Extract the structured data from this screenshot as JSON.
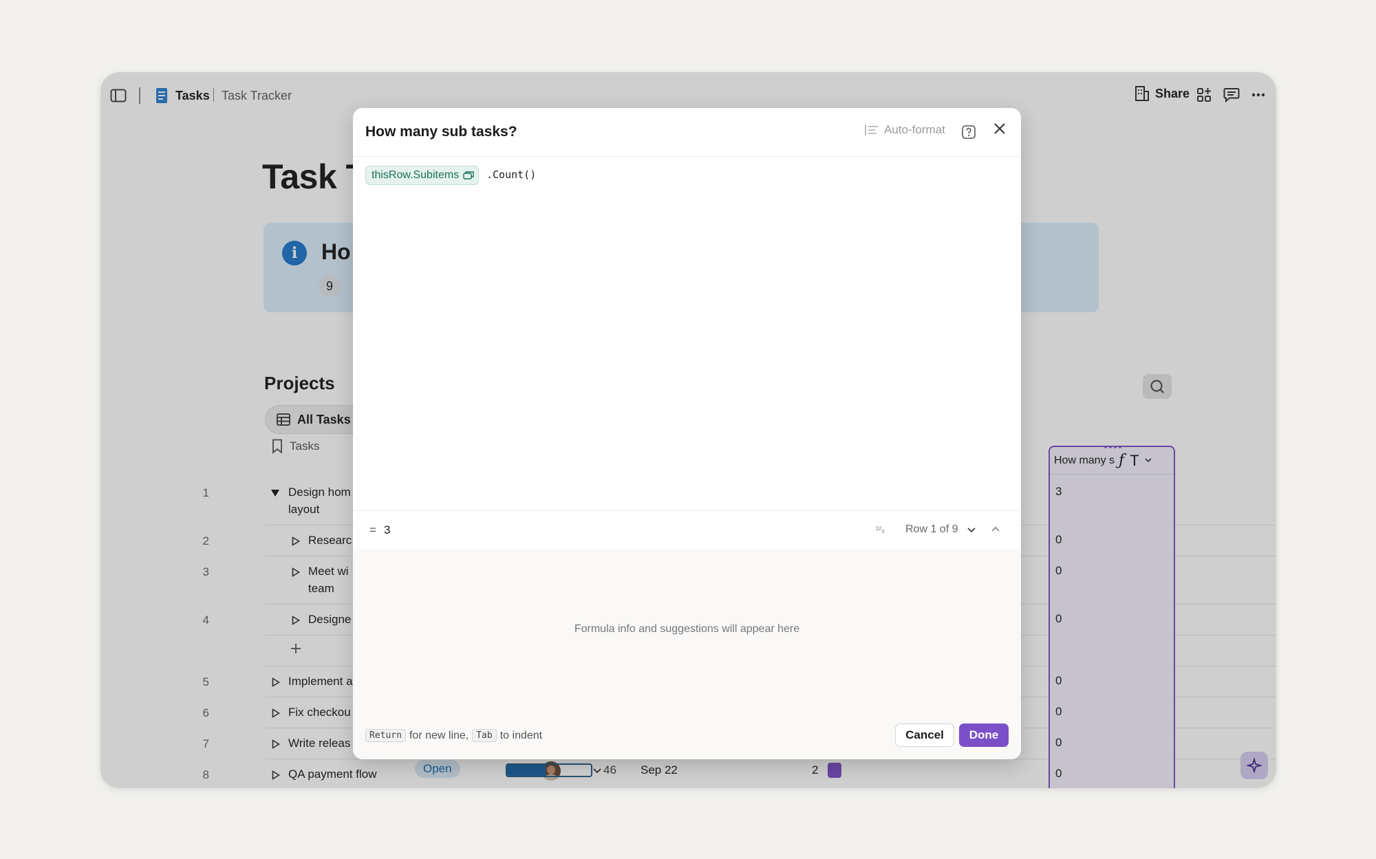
{
  "breadcrumb": {
    "title": "Tasks",
    "subtitle": "Task Tracker"
  },
  "topbar": {
    "share_label": "Share"
  },
  "doc": {
    "title": "Task T",
    "callout_title": "Ho",
    "callout_count": "9"
  },
  "table": {
    "section_title": "Projects",
    "view_label": "All Tasks",
    "tasks_header": "Tasks",
    "formula_header": "How many s",
    "rows": [
      {
        "num": "1",
        "text_line1": "Design hom",
        "text_line2": "layout",
        "formula": "3"
      },
      {
        "num": "2",
        "text_line1": "Researc",
        "formula": "0"
      },
      {
        "num": "3",
        "text_line1": "Meet wi",
        "text_line2": "team",
        "formula": "0"
      },
      {
        "num": "4",
        "text_line1": "Designe",
        "formula": "0"
      },
      {
        "num": "5",
        "text_line1": "Implement a",
        "formula": "0"
      },
      {
        "num": "6",
        "text_line1": "Fix checkou",
        "formula": "0"
      },
      {
        "num": "7",
        "text_line1": "Write releas",
        "formula": "0"
      },
      {
        "num": "8",
        "text_line1": "QA payment flow",
        "formula": "0",
        "status": "Open",
        "progress_value": "46",
        "progress_fraction": 0.46,
        "date": "Sep 22",
        "count": "2"
      }
    ]
  },
  "dialog": {
    "title": "How many sub tasks?",
    "autoformat_label": "Auto-format",
    "formula_token": "thisRow.Subitems",
    "formula_rest": ".Count()",
    "result_eq": "=",
    "result_value": "3",
    "number_format": "¹²₃",
    "row_info": "Row 1 of 9",
    "info_message": "Formula info and suggestions will appear here",
    "hint_key1": "Return",
    "hint_text1": "for new line,",
    "hint_key2": "Tab",
    "hint_text2": "to indent",
    "cancel_label": "Cancel",
    "done_label": "Done"
  },
  "colors": {
    "accent": "#7b4fc7",
    "token_text": "#1e6f5c",
    "info_blue": "#1f78c9"
  }
}
